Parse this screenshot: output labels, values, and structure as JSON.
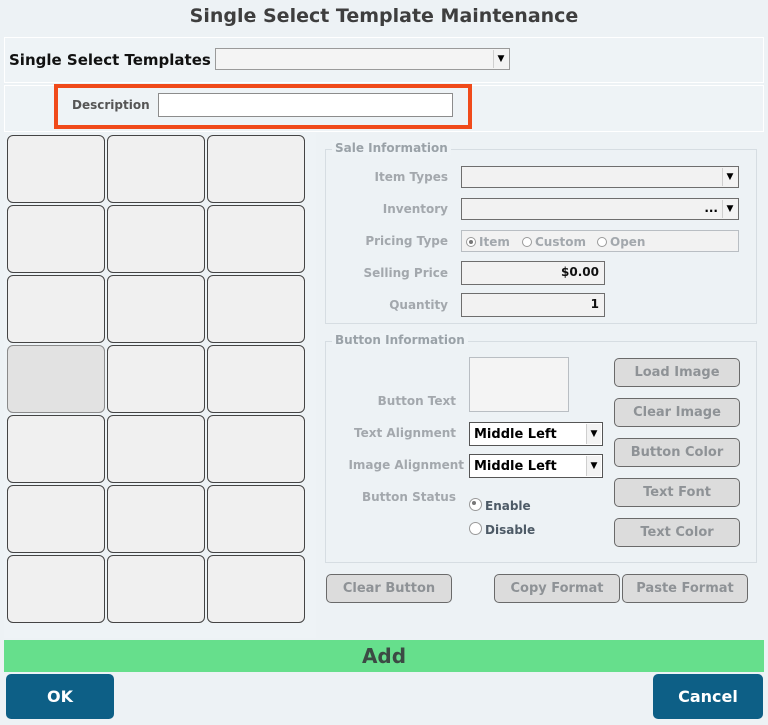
{
  "window": {
    "title": "Single Select Template Maintenance"
  },
  "templates": {
    "label": "Single Select Templates",
    "selected": ""
  },
  "description": {
    "label": "Description",
    "value": ""
  },
  "sale_info": {
    "legend": "Sale Information",
    "item_types_label": "Item Types",
    "item_types_value": "",
    "inventory_label": "Inventory",
    "inventory_ellipsis": "...",
    "pricing_type_label": "Pricing Type",
    "pricing_options": [
      "Item",
      "Custom",
      "Open"
    ],
    "pricing_selected": "Item",
    "selling_price_label": "Selling Price",
    "selling_price_value": "$0.00",
    "quantity_label": "Quantity",
    "quantity_value": "1"
  },
  "button_info": {
    "legend": "Button Information",
    "button_text_label": "Button Text",
    "text_alignment_label": "Text Alignment",
    "text_alignment_value": "Middle Left",
    "image_alignment_label": "Image Alignment",
    "image_alignment_value": "Middle Left",
    "button_status_label": "Button Status",
    "status_options": [
      "Enable",
      "Disable"
    ],
    "status_selected": "Enable",
    "load_image": "Load Image",
    "clear_image": "Clear Image",
    "button_color": "Button Color",
    "text_font": "Text Font",
    "text_color": "Text Color"
  },
  "actions": {
    "clear_button": "Clear Button",
    "copy_format": "Copy Format",
    "paste_format": "Paste Format",
    "add": "Add",
    "ok": "OK",
    "cancel": "Cancel"
  },
  "grid": {
    "rows": 7,
    "cols": 3,
    "selected_index": 9
  },
  "colors": {
    "accent_blue": "#0d5f86",
    "add_green": "#66df8c",
    "highlight": "#f04a1a"
  }
}
